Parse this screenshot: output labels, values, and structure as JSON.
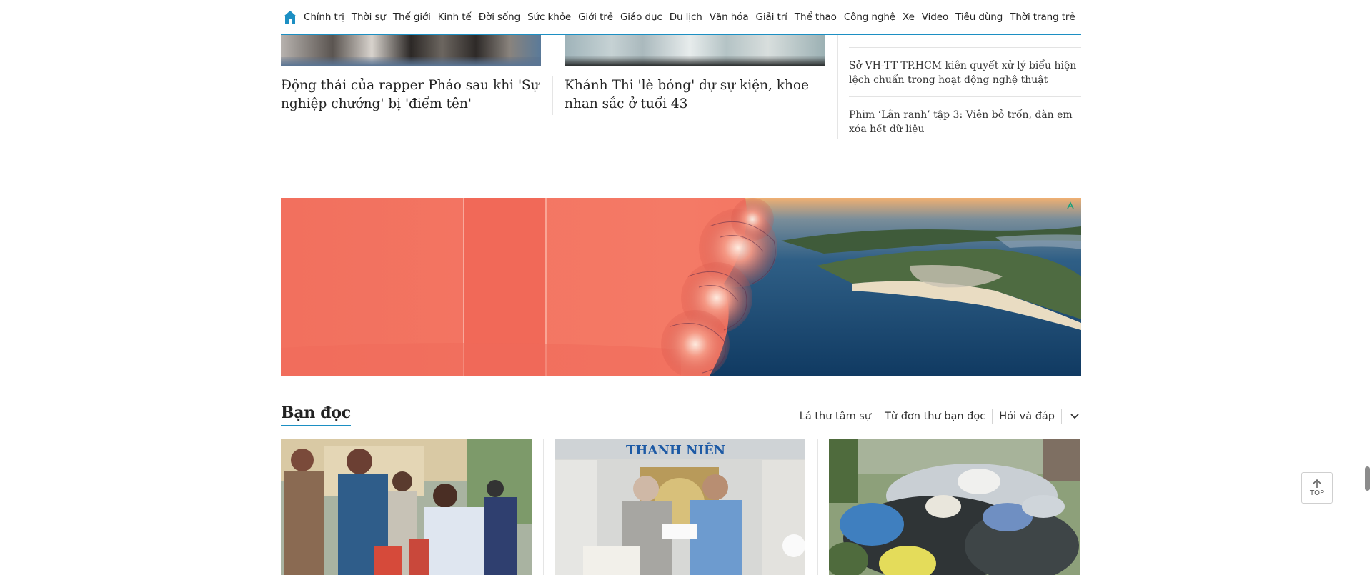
{
  "nav": {
    "items": [
      "Chính trị",
      "Thời sự",
      "Thế giới",
      "Kinh tế",
      "Đời sống",
      "Sức khỏe",
      "Giới trẻ",
      "Giáo dục",
      "Du lịch",
      "Văn hóa",
      "Giải trí",
      "Thể thao",
      "Công nghệ",
      "Xe",
      "Video",
      "Tiêu dùng",
      "Thời trang trẻ"
    ],
    "accent": "#1c8fc3"
  },
  "top_articles": [
    {
      "title": "Động thái của rapper Pháo sau khi 'Sự nghiệp chướng' bị 'điểm tên'"
    },
    {
      "title": "Khánh Thi 'lè bóng' dự sự kiện, khoe nhan sắc ở tuổi 43"
    }
  ],
  "side_articles": [
    {
      "title": "Sở VH-TT TP.HCM kiên quyết xử lý biểu hiện lệch chuẩn trong hoạt động nghệ thuật"
    },
    {
      "title": "Phim ‘Lằn ranh’ tập 3: Viên bỏ trốn, đàn em xóa hết dữ liệu"
    }
  ],
  "section": {
    "title": "Bạn đọc",
    "tabs": [
      "Lá thư tâm sự",
      "Từ đơn thư bạn đọc",
      "Hỏi và đáp"
    ]
  },
  "back_to_top": {
    "label": "TOP"
  }
}
